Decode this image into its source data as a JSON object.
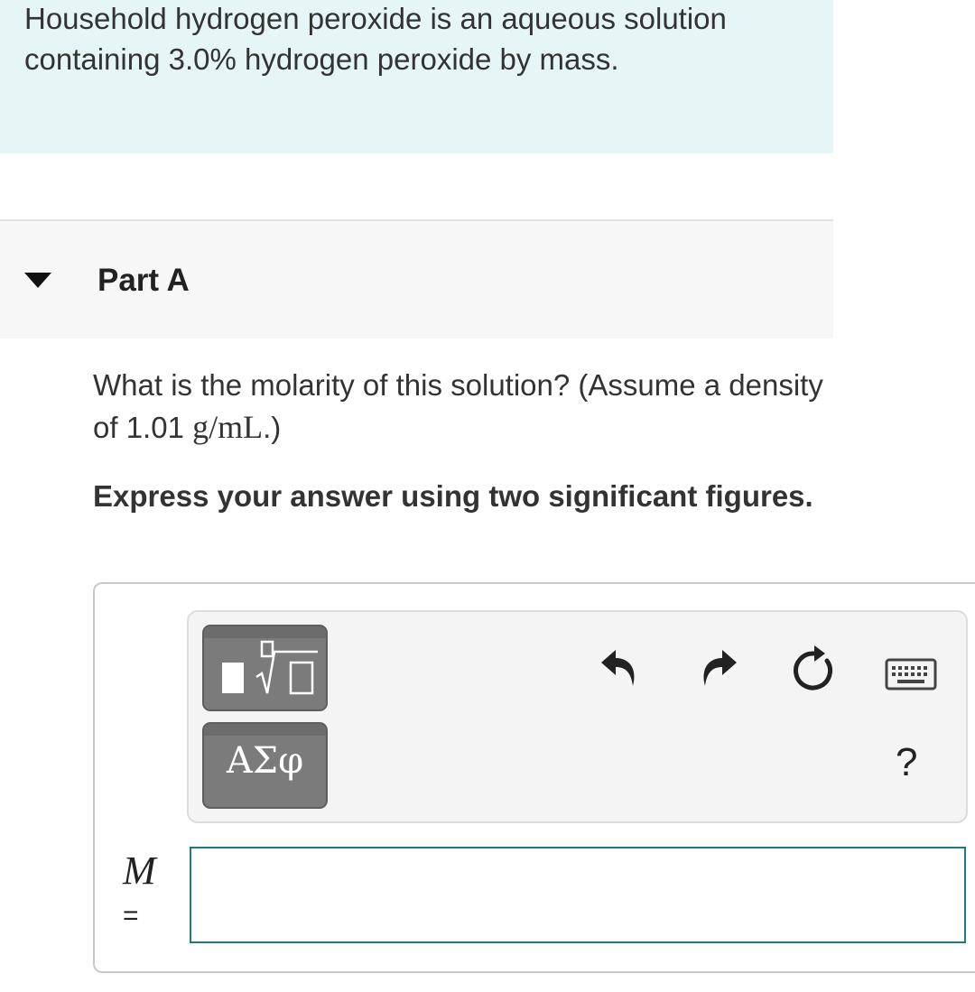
{
  "intro": {
    "text": "Household hydrogen peroxide is an aqueous solution containing 3.0% hydrogen peroxide by mass."
  },
  "part": {
    "title": "Part A"
  },
  "question": {
    "text_before": "What is the molarity of this solution? (Assume a density of 1.01 ",
    "unit": "g/mL",
    "text_after": ".)"
  },
  "instruction": {
    "text": "Express your answer using two significant figures."
  },
  "toolbar": {
    "greek_label": "ΑΣφ",
    "help_label": "?",
    "icons": [
      "templates-icon",
      "undo-icon",
      "redo-icon",
      "reset-icon",
      "keyboard-icon",
      "help-icon"
    ]
  },
  "answer": {
    "variable": "M",
    "equals": "=",
    "value": ""
  },
  "colors": {
    "intro_background": "#e6f5f5",
    "input_border": "#1d7a80",
    "tool_button": "#7b7b7b"
  }
}
